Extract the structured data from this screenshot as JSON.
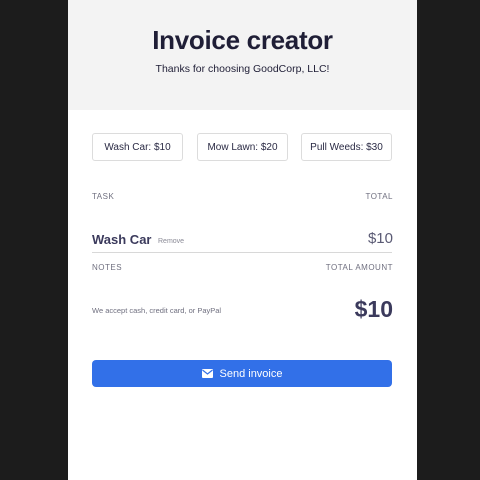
{
  "header": {
    "title": "Invoice creator",
    "subtitle": "Thanks for choosing GoodCorp, LLC!"
  },
  "services": [
    {
      "label": "Wash Car: $10"
    },
    {
      "label": "Mow Lawn: $20"
    },
    {
      "label": "Pull Weeds: $30"
    }
  ],
  "table": {
    "task_header": "TASK",
    "total_header": "TOTAL",
    "items": [
      {
        "name": "Wash Car",
        "remove_label": "Remove",
        "price": "$10"
      }
    ]
  },
  "summary": {
    "notes_header": "NOTES",
    "total_amount_header": "TOTAL AMOUNT",
    "notes_text": "We accept cash, credit card, or PayPal",
    "total_amount": "$10"
  },
  "send": {
    "label": "Send invoice",
    "icon": "envelope-icon"
  },
  "colors": {
    "accent": "#3270e8",
    "header_bg": "#f3f3f3",
    "page_bg": "#1c1c1c",
    "text_dark": "#1f1e36"
  }
}
